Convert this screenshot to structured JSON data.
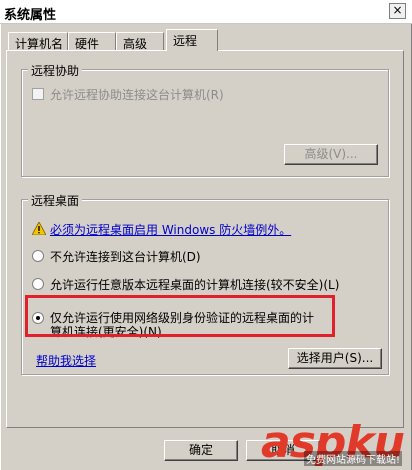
{
  "window": {
    "title": "系统属性",
    "close_symbol": "×"
  },
  "tabs": [
    {
      "label": "计算机名"
    },
    {
      "label": "硬件"
    },
    {
      "label": "高级"
    },
    {
      "label": "远程",
      "active": true
    }
  ],
  "remote_assistance": {
    "group_title": "远程协助",
    "allow_checkbox_label": "允许远程协助连接这台计算机(R)",
    "allow_checked": false,
    "advanced_button": "高级(V)..."
  },
  "remote_desktop": {
    "group_title": "远程桌面",
    "firewall_warning": "必须为远程桌面启用 Windows 防火墙例外。",
    "options": [
      {
        "label": "不允许连接到这台计算机(D)",
        "selected": false
      },
      {
        "label": "允许运行任意版本远程桌面的计算机连接(较不安全)(L)",
        "selected": false
      },
      {
        "label_line1": "仅允许运行使用网络级别身份验证的远程桌面的计",
        "label_line2": "算机连接(更安全)(N)",
        "selected": true
      }
    ],
    "help_link": "帮助我选择",
    "select_users_button": "选择用户(S)..."
  },
  "footer": {
    "ok_button": "确定",
    "cancel_button": "取消"
  },
  "watermark": {
    "main": "aspku",
    "sub": "免费网站源码下载站!"
  },
  "colors": {
    "highlight": "#e0202a",
    "link": "#0000cc",
    "dialog_bg": "#d4d0c8"
  }
}
